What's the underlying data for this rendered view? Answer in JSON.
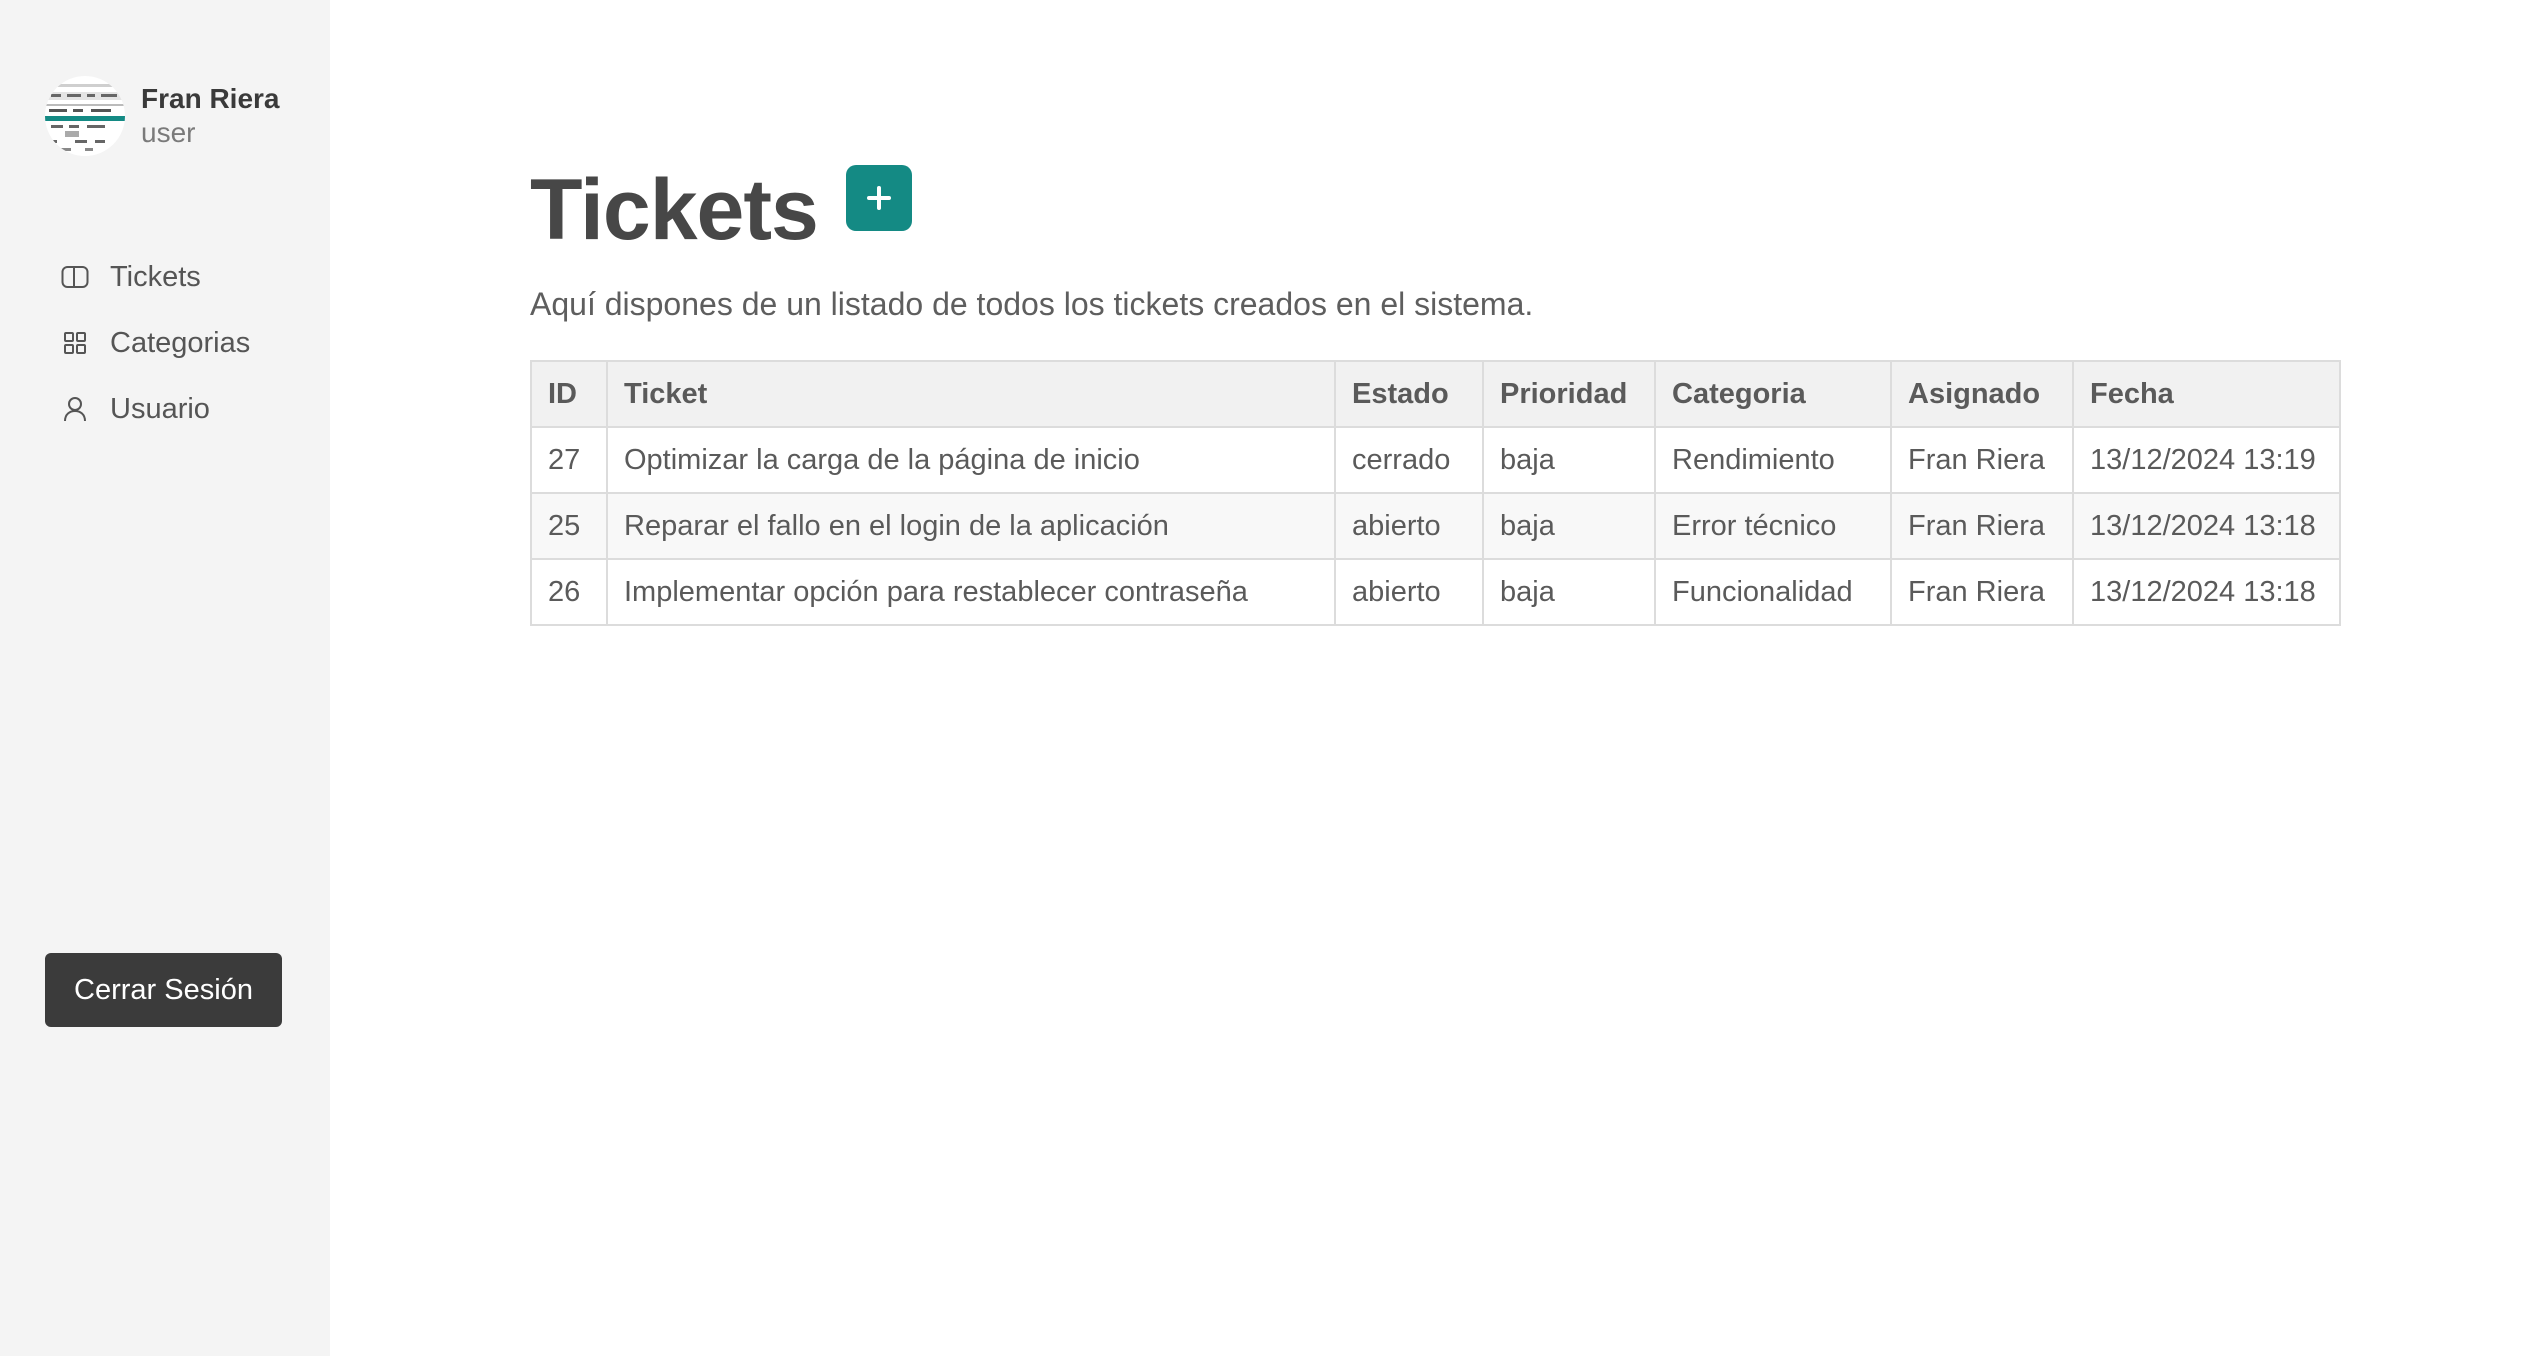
{
  "user": {
    "name": "Fran Riera",
    "role": "user"
  },
  "sidebar": {
    "items": [
      {
        "label": "Tickets",
        "icon": "ticket-icon"
      },
      {
        "label": "Categorias",
        "icon": "grid-icon"
      },
      {
        "label": "Usuario",
        "icon": "user-icon"
      }
    ],
    "logout_label": "Cerrar Sesión"
  },
  "page": {
    "title": "Tickets",
    "add_icon": "plus-icon",
    "subtitle": "Aquí dispones de un listado de todos los tickets creados en el sistema."
  },
  "table": {
    "columns": [
      "ID",
      "Ticket",
      "Estado",
      "Prioridad",
      "Categoria",
      "Asignado",
      "Fecha"
    ],
    "rows": [
      [
        "27",
        "Optimizar la carga de la página de inicio",
        "cerrado",
        "baja",
        "Rendimiento",
        "Fran Riera",
        "13/12/2024 13:19"
      ],
      [
        "25",
        "Reparar el fallo en el login de la aplicación",
        "abierto",
        "baja",
        "Error técnico",
        "Fran Riera",
        "13/12/2024 13:18"
      ],
      [
        "26",
        "Implementar opción para restablecer contraseña",
        "abierto",
        "baja",
        "Funcionalidad",
        "Fran Riera",
        "13/12/2024 13:18"
      ]
    ]
  },
  "colors": {
    "accent": "#148a84",
    "sidebar_bg": "#f4f4f4",
    "logout_bg": "#3b3b3b"
  }
}
